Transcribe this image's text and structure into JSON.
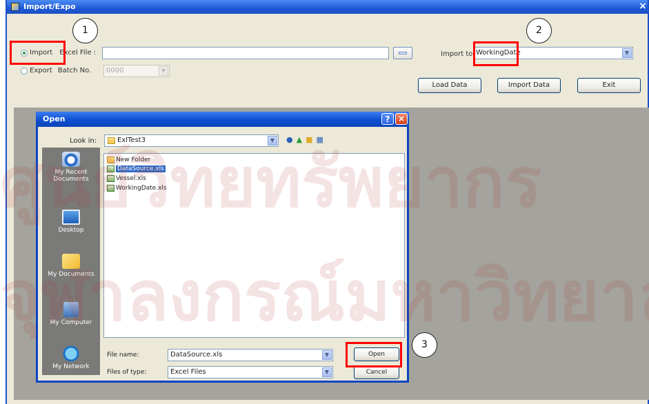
{
  "window": {
    "title": "Import/Expo",
    "close_glyph": "×"
  },
  "import_export": {
    "import_label": "Import",
    "export_label": "Export",
    "excel_file_label": "Excel File :",
    "excel_file_value": "",
    "batch_no_label": "Batch No.",
    "batch_no_value": "0000",
    "import_to_label": "Import to",
    "import_to_value": "WorkingDate"
  },
  "buttons": {
    "load_data": "Load Data",
    "import_data": "Import Data",
    "exit": "Exit"
  },
  "open_dialog": {
    "title": "Open",
    "help_glyph": "?",
    "close_glyph": "×",
    "look_in_label": "Look in:",
    "look_in_value": "ExlTest3",
    "places": [
      "My Recent Documents",
      "Desktop",
      "My Documents",
      "My Computer",
      "My Network"
    ],
    "files": [
      {
        "name": "New Folder",
        "type": "folder"
      },
      {
        "name": "DataSource.xls",
        "type": "xls",
        "selected": true
      },
      {
        "name": "Vessel.xls",
        "type": "xls"
      },
      {
        "name": "WorkingDate.xls",
        "type": "xls"
      }
    ],
    "file_name_label": "File name:",
    "file_name_value": "DataSource.xls",
    "files_of_type_label": "Files of type:",
    "files_of_type_value": "Excel Files",
    "open_button": "Open",
    "cancel_button": "Cancel"
  },
  "callouts": [
    "1",
    "2",
    "3"
  ],
  "watermark": {
    "line1": "ศูนย์วิทยทรัพยากร",
    "line2": "จุฬาลงกรณ์มหาวิทยาลัย"
  },
  "colors": {
    "highlight_red": "#ff0000",
    "title_blue": "#1e5ad6",
    "selection_blue": "#316ac5"
  }
}
